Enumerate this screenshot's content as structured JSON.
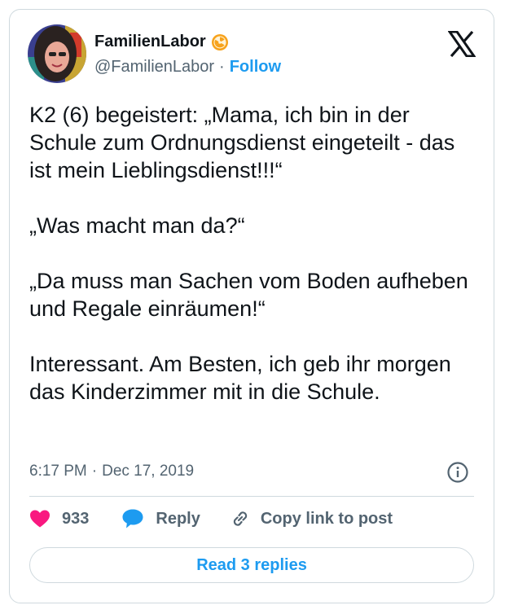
{
  "author": {
    "display_name": "FamilienLabor",
    "handle": "@FamilienLabor",
    "separator": "·",
    "follow_label": "Follow",
    "badge_icon": "radioactive-badge-icon",
    "badge_color": "#f7a21b"
  },
  "tweet": {
    "text": "K2 (6) begeistert: „Mama, ich bin in der Schule zum Ordnungsdienst eingeteilt - das ist mein Lieblingsdienst!!!“\n\n„Was macht man da?“\n\n„Da muss man Sachen vom Boden aufheben und Regale einräumen!“\n\nInteressant. Am Besten, ich geb ihr morgen das Kinderzimmer mit in die Schule.",
    "time": "6:17 PM",
    "separator": "·",
    "date": "Dec 17, 2019"
  },
  "actions": {
    "like_count": "933",
    "reply_label": "Reply",
    "copy_label": "Copy link to post"
  },
  "footer": {
    "read_replies_label": "Read 3 replies"
  },
  "colors": {
    "accent": "#1d9bf0",
    "like": "#f91880",
    "secondary_text": "#536471",
    "border": "#cfd9de"
  }
}
